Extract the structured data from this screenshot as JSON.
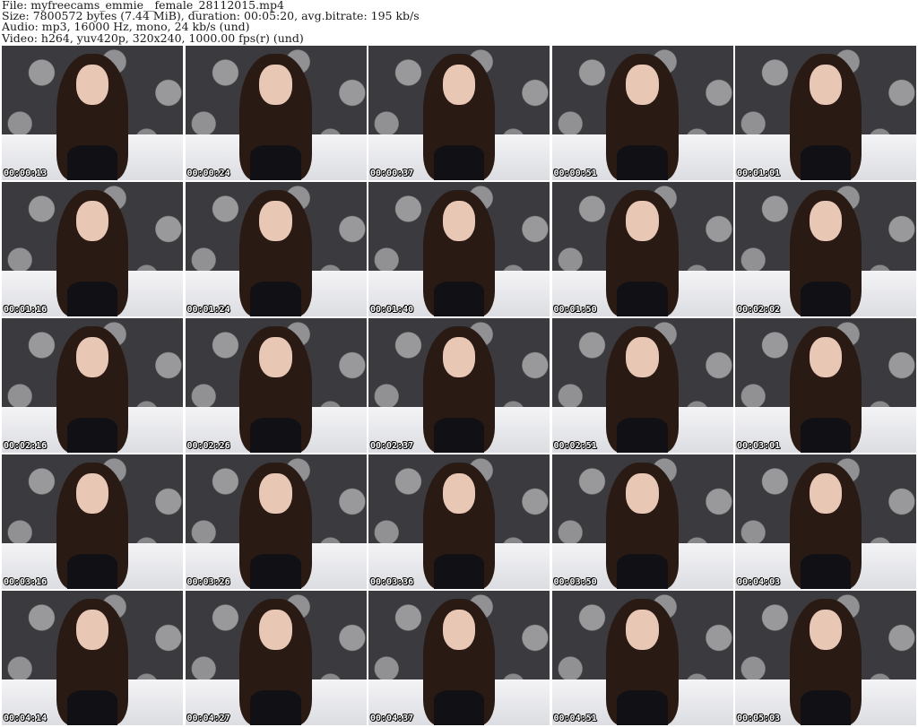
{
  "header": {
    "file": "File: myfreecams_emmie__female_28112015.mp4",
    "size": "Size: 7800572 bytes (7.44 MiB), duration: 00:05:20, avg.bitrate: 195 kb/s",
    "audio": "Audio: mp3, 16000 Hz, mono, 24 kb/s (und)",
    "video": "Video: h264, yuv420p, 320x240, 1000.00 fps(r) (und)"
  },
  "thumbnails": [
    {
      "timestamp": "00:00:13"
    },
    {
      "timestamp": "00:00:24"
    },
    {
      "timestamp": "00:00:37"
    },
    {
      "timestamp": "00:00:51"
    },
    {
      "timestamp": "00:01:01"
    },
    {
      "timestamp": "00:01:16"
    },
    {
      "timestamp": "00:01:24"
    },
    {
      "timestamp": "00:01:40"
    },
    {
      "timestamp": "00:01:50"
    },
    {
      "timestamp": "00:02:02"
    },
    {
      "timestamp": "00:02:16"
    },
    {
      "timestamp": "00:02:26"
    },
    {
      "timestamp": "00:02:37"
    },
    {
      "timestamp": "00:02:51"
    },
    {
      "timestamp": "00:03:01"
    },
    {
      "timestamp": "00:03:16"
    },
    {
      "timestamp": "00:03:26"
    },
    {
      "timestamp": "00:03:36"
    },
    {
      "timestamp": "00:03:50"
    },
    {
      "timestamp": "00:04:03"
    },
    {
      "timestamp": "00:04:14"
    },
    {
      "timestamp": "00:04:27"
    },
    {
      "timestamp": "00:04:37"
    },
    {
      "timestamp": "00:04:51"
    },
    {
      "timestamp": "00:05:03"
    }
  ]
}
